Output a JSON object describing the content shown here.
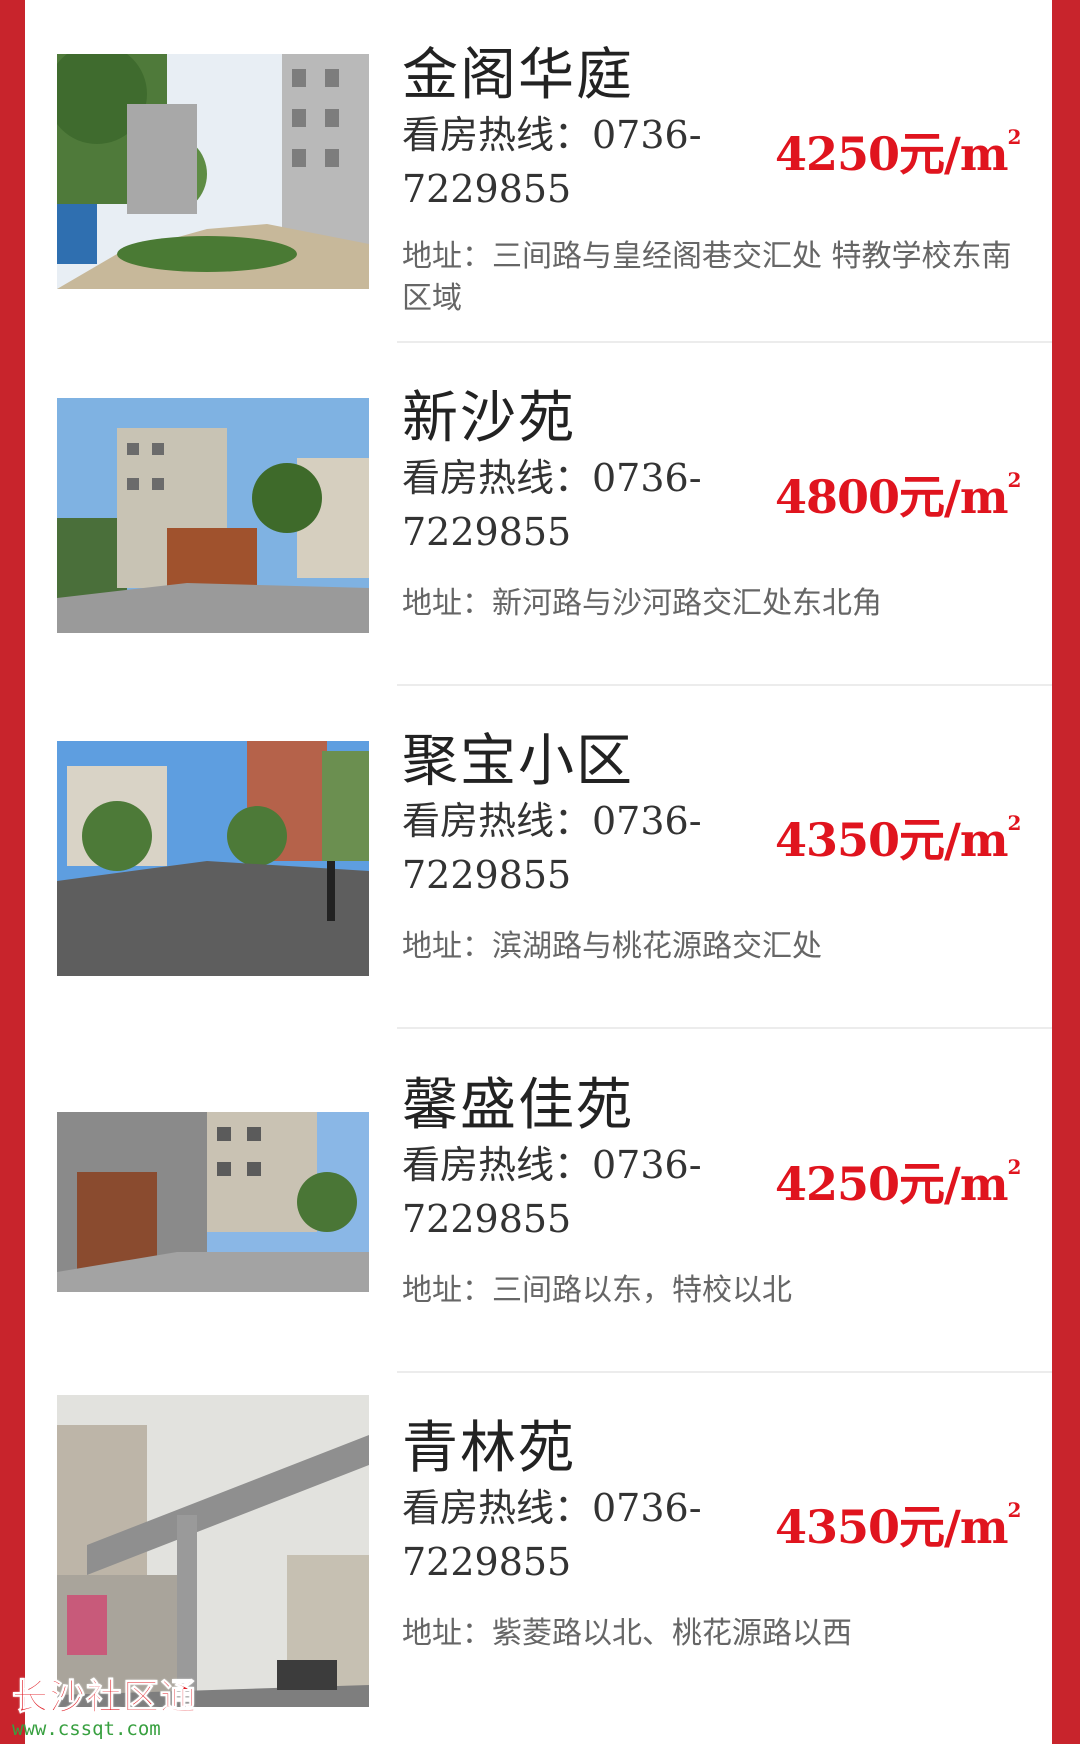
{
  "listings": [
    {
      "name": "金阁华庭",
      "hotline": "看房热线：0736-7229855",
      "price": "4250元/m",
      "price_unit_sup": "2",
      "address": "地址：三间路与皇经阁巷交汇处 特教学校东南区域"
    },
    {
      "name": "新沙苑",
      "hotline": "看房热线：0736-7229855",
      "price": "4800元/m",
      "price_unit_sup": "2",
      "address": "地址：新河路与沙河路交汇处东北角"
    },
    {
      "name": "聚宝小区",
      "hotline": "看房热线：0736-7229855",
      "price": "4350元/m",
      "price_unit_sup": "2",
      "address": "地址：滨湖路与桃花源路交汇处"
    },
    {
      "name": "馨盛佳苑",
      "hotline": "看房热线：0736-7229855",
      "price": "4250元/m",
      "price_unit_sup": "2",
      "address": "地址：三间路以东，特校以北"
    },
    {
      "name": "青林苑",
      "hotline": "看房热线：0736-7229855",
      "price": "4350元/m",
      "price_unit_sup": "2",
      "address": "地址：紫菱路以北、桃花源路以西"
    }
  ],
  "watermark": {
    "title": "长沙社区通",
    "url": "www.cssqt.com"
  },
  "colors": {
    "frame_red": "#c8242c",
    "price_red": "#e0141e"
  }
}
